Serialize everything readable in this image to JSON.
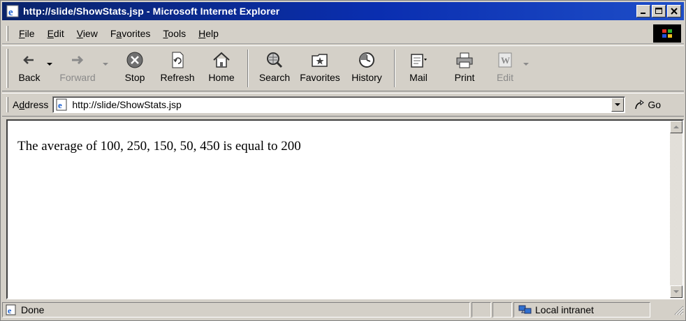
{
  "window": {
    "title": "http://slide/ShowStats.jsp - Microsoft Internet Explorer",
    "title_bar_color": "#0a246a"
  },
  "menu": {
    "items": [
      {
        "label": "File",
        "key": "F",
        "rest": "ile"
      },
      {
        "label": "Edit",
        "key": "E",
        "rest": "dit"
      },
      {
        "label": "View",
        "key": "V",
        "rest": "iew"
      },
      {
        "label": "Favorites",
        "pre": "F",
        "key": "a",
        "rest": "vorites"
      },
      {
        "label": "Tools",
        "key": "T",
        "rest": "ools"
      },
      {
        "label": "Help",
        "key": "H",
        "rest": "elp"
      }
    ]
  },
  "toolbar": {
    "back": {
      "label": "Back",
      "icon": "back-arrow-icon"
    },
    "forward": {
      "label": "Forward",
      "icon": "forward-arrow-icon",
      "enabled": false
    },
    "stop": {
      "label": "Stop",
      "icon": "stop-icon"
    },
    "refresh": {
      "label": "Refresh",
      "icon": "refresh-icon"
    },
    "home": {
      "label": "Home",
      "icon": "home-icon"
    },
    "search": {
      "label": "Search",
      "icon": "search-globe-icon"
    },
    "favorites": {
      "label": "Favorites",
      "icon": "favorites-folder-icon"
    },
    "history": {
      "label": "History",
      "icon": "history-clock-icon"
    },
    "mail": {
      "label": "Mail",
      "icon": "mail-icon"
    },
    "print": {
      "label": "Print",
      "icon": "printer-icon"
    },
    "edit": {
      "label": "Edit",
      "icon": "word-edit-icon",
      "enabled": false
    }
  },
  "address": {
    "label_pre": "A",
    "label_key": "d",
    "label_rest": "dress",
    "url": "http://slide/ShowStats.jsp",
    "go_label": "Go"
  },
  "page": {
    "text": "The average of 100, 250, 150, 50, 450 is equal to 200"
  },
  "status": {
    "text": "Done",
    "zone": "Local intranet"
  }
}
